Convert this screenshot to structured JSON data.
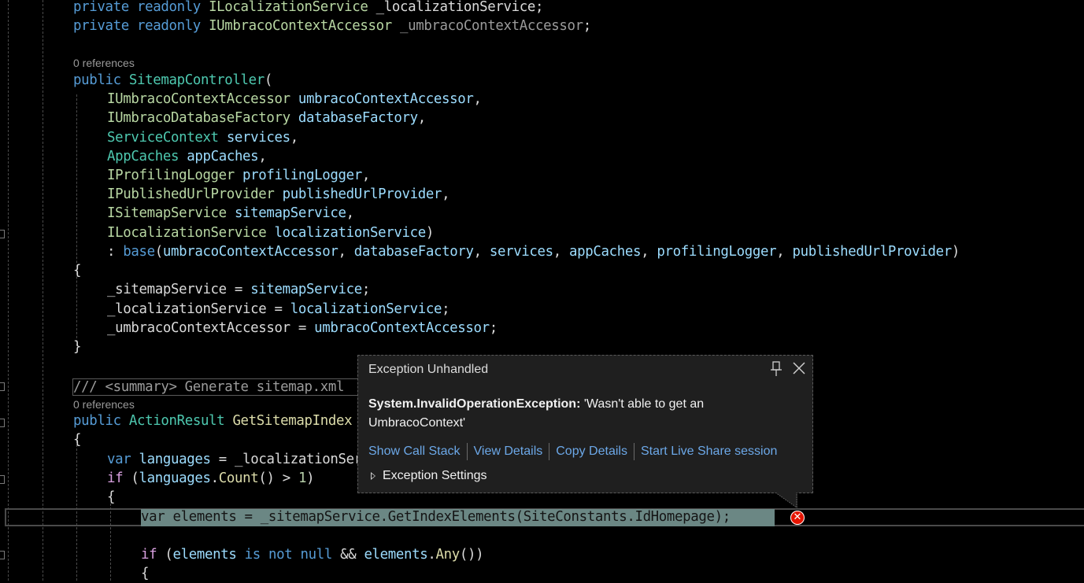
{
  "editor": {
    "codelens": {
      "ctor": "0 references",
      "method": "0 references"
    },
    "lines": {
      "l1": [
        "private",
        " ",
        "readonly",
        " ",
        "ILocalizationService",
        " ",
        "_localizationService",
        ";"
      ],
      "l2": [
        "private",
        " ",
        "readonly",
        " ",
        "IUmbracoContextAccessor",
        " ",
        "_umbracoContextAccessor",
        ";"
      ],
      "l4": [
        "public",
        " ",
        "SitemapController",
        "("
      ],
      "p1": [
        "IUmbracoContextAccessor",
        " ",
        "umbracoContextAccessor",
        ","
      ],
      "p2": [
        "IUmbracoDatabaseFactory",
        " ",
        "databaseFactory",
        ","
      ],
      "p3": [
        "ServiceContext",
        " ",
        "services",
        ","
      ],
      "p4": [
        "AppCaches",
        " ",
        "appCaches",
        ","
      ],
      "p5": [
        "IProfilingLogger",
        " ",
        "profilingLogger",
        ","
      ],
      "p6": [
        "IPublishedUrlProvider",
        " ",
        "publishedUrlProvider",
        ","
      ],
      "p7": [
        "ISitemapService",
        " ",
        "sitemapService",
        ","
      ],
      "p8": [
        "ILocalizationService",
        " ",
        "localizationService",
        ")"
      ],
      "base": [
        ": ",
        "base",
        "(",
        "umbracoContextAccessor",
        ", ",
        "databaseFactory",
        ", ",
        "services",
        ", ",
        "appCaches",
        ", ",
        "profilingLogger",
        ", ",
        "publishedUrlProvider",
        ")"
      ],
      "open1": "{",
      "a1": [
        "_sitemapService",
        " = ",
        "sitemapService",
        ";"
      ],
      "a2": [
        "_localizationService",
        " = ",
        "localizationService",
        ";"
      ],
      "a3": [
        "_umbracoContextAccessor",
        " = ",
        "umbracoContextAccessor",
        ";"
      ],
      "close1": "}",
      "summary": "/// <summary> Generate sitemap.xml",
      "m1": [
        "public",
        " ",
        "ActionResult",
        " ",
        "GetSitemapIndex"
      ],
      "open2": "{",
      "v1": [
        "var",
        " ",
        "languages",
        " = ",
        "_localizationService"
      ],
      "if1": [
        "if",
        " (",
        "languages",
        ".",
        "Count",
        "() > ",
        "1",
        ")"
      ],
      "open3": "{",
      "cur": "var elements = _sitemapService.GetIndexElements(SiteConstants.IdHomepage);",
      "if2": [
        "if",
        " (",
        "elements",
        " ",
        "is",
        " ",
        "not",
        " ",
        "null",
        " && ",
        "elements",
        ".",
        "Any",
        "())"
      ],
      "open4": "{"
    }
  },
  "exception_popup": {
    "title": "Exception Unhandled",
    "exception_type": "System.InvalidOperationException:",
    "message": " 'Wasn't able to get an UmbracoContext'",
    "links": [
      "Show Call Stack",
      "View Details",
      "Copy Details",
      "Start Live Share session"
    ],
    "settings_label": "Exception Settings",
    "pin_icon": "pin-icon",
    "close_icon": "close-icon"
  },
  "error_marker": {
    "icon": "error-x-icon",
    "symbol": "✕"
  },
  "colors": {
    "keyword": "#569cd6",
    "control": "#d8a0df",
    "class": "#4ec9b0",
    "interface": "#b8d7a3",
    "parameter": "#9cdcfe",
    "method": "#dcdcaa",
    "number": "#b5cea8",
    "link": "#6ca8e8",
    "error": "#e51400",
    "current_statement_bg": "#6b8784"
  }
}
